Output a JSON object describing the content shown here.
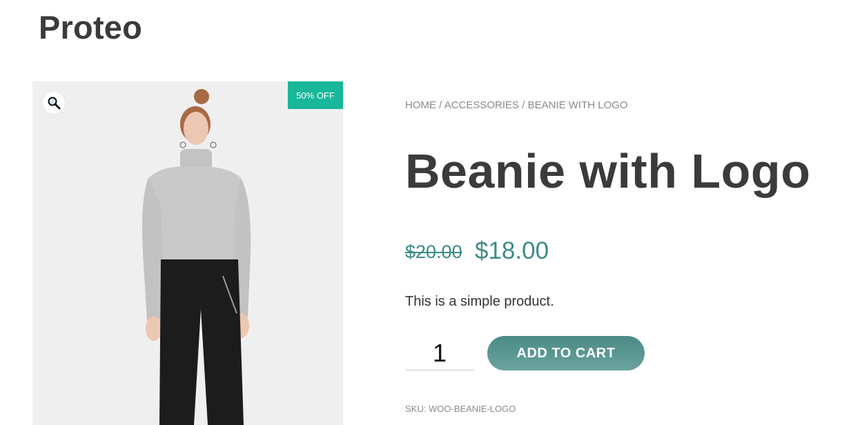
{
  "site": {
    "title": "Proteo"
  },
  "gallery": {
    "image_description_icon": "product-photo",
    "zoom_icon": "magnifier-icon",
    "badge": "50% OFF",
    "badge_color": "#17b79a"
  },
  "breadcrumb": {
    "items": [
      "HOME",
      "ACCESSORIES",
      "BEANIE WITH LOGO"
    ],
    "separator": "/"
  },
  "product": {
    "title": "Beanie with Logo",
    "price_old": "$20.00",
    "price_new": "$18.00",
    "price_color": "#3d8a87",
    "short_description": "This is a simple product.",
    "quantity": "1",
    "add_to_cart_label": "ADD TO CART",
    "sku_label": "SKU:",
    "sku_value": "WOO-BEANIE-LOGO"
  }
}
